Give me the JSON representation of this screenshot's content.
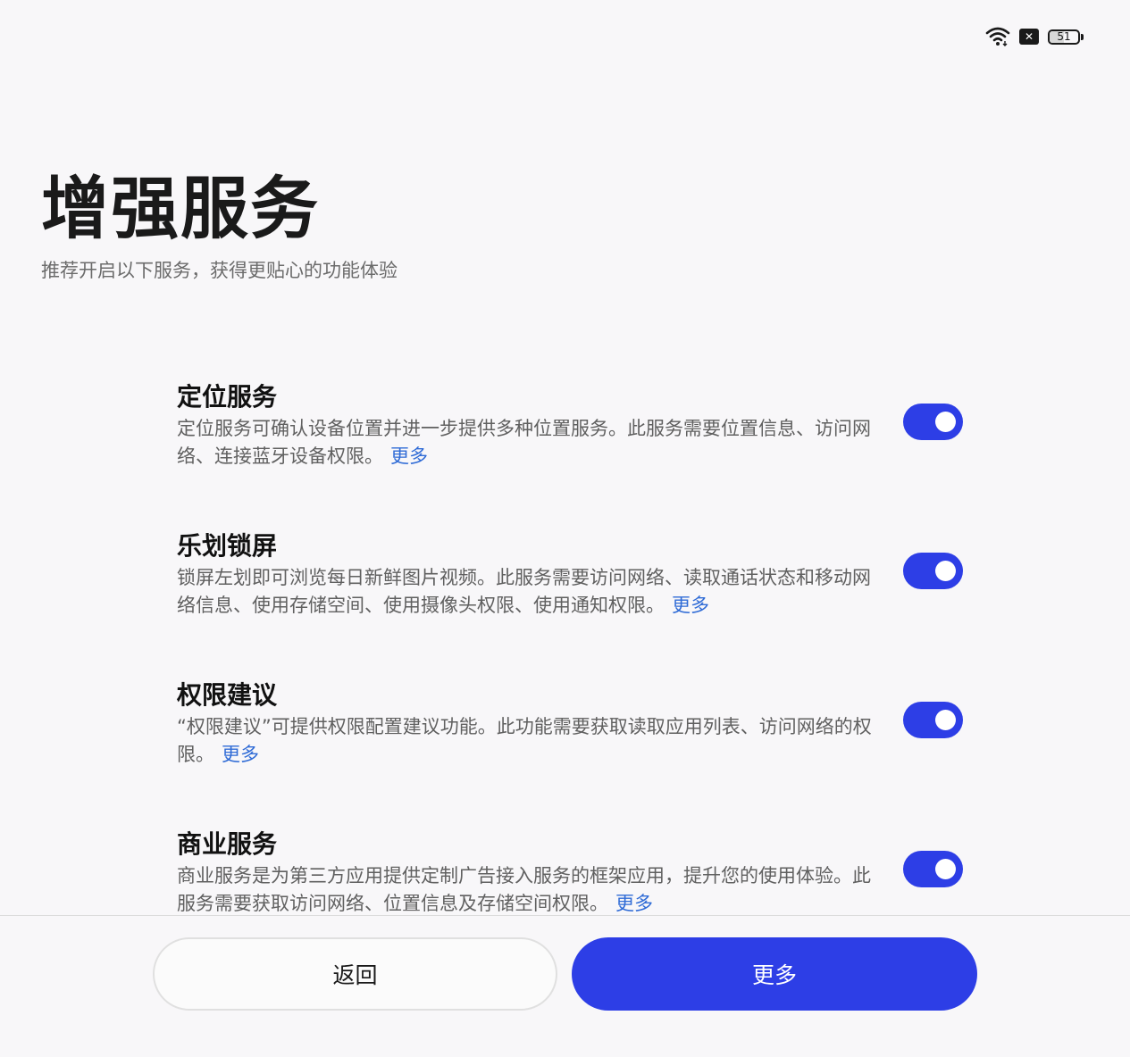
{
  "status_bar": {
    "battery_level": "51",
    "battery_fraction": 0.51,
    "sim_icon": "x-mark-icon",
    "wifi_icon": "wifi-icon"
  },
  "header": {
    "title": "增强服务",
    "subtitle": "推荐开启以下服务，获得更贴心的功能体验"
  },
  "services": [
    {
      "title": "定位服务",
      "description": "定位服务可确认设备位置并进一步提供多种位置服务。此服务需要位置信息、访问网络、连接蓝牙设备权限。",
      "more_label": "更多",
      "enabled": true
    },
    {
      "title": "乐划锁屏",
      "description": "锁屏左划即可浏览每日新鲜图片视频。此服务需要访问网络、读取通话状态和移动网络信息、使用存储空间、使用摄像头权限、使用通知权限。",
      "more_label": "更多",
      "enabled": true
    },
    {
      "title": "权限建议",
      "description": "“权限建议”可提供权限配置建议功能。此功能需要获取读取应用列表、访问网络的权限。",
      "more_label": "更多",
      "enabled": true
    },
    {
      "title": "商业服务",
      "description": "商业服务是为第三方应用提供定制广告接入服务的框架应用，提升您的使用体验。此服务需要获取访问网络、位置信息及存储空间权限。",
      "more_label": "更多",
      "enabled": true
    }
  ],
  "footer": {
    "back_label": "返回",
    "more_label": "更多"
  },
  "colors": {
    "accent": "#2d3ee6",
    "link": "#2f6bd6",
    "background": "#f8f7f9"
  }
}
